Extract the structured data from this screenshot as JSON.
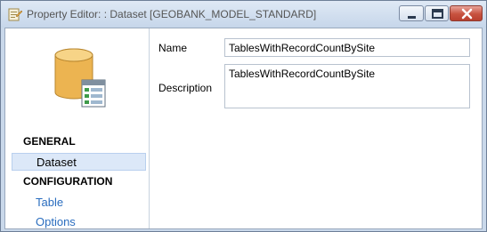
{
  "window": {
    "title": "Property Editor: : Dataset [GEOBANK_MODEL_STANDARD]",
    "icons": [
      "property-editor-app-icon",
      "minimize-icon",
      "maximize-icon",
      "close-icon"
    ]
  },
  "sidebar": {
    "icon": "dataset-table-icon",
    "sections": [
      {
        "header": "GENERAL",
        "items": [
          {
            "label": "Dataset",
            "selected": true
          }
        ]
      },
      {
        "header": "CONFIGURATION",
        "items": [
          {
            "label": "Table",
            "selected": false
          },
          {
            "label": "Options",
            "selected": false
          }
        ]
      }
    ]
  },
  "form": {
    "name_label": "Name",
    "name_value": "TablesWithRecordCountBySite",
    "description_label": "Description",
    "description_value": "TablesWithRecordCountBySite"
  },
  "colors": {
    "accent_link": "#2a6dbf",
    "selection_bg": "#dce8f8",
    "close_button": "#c8523f",
    "title_bar": "#c6d6ea"
  }
}
